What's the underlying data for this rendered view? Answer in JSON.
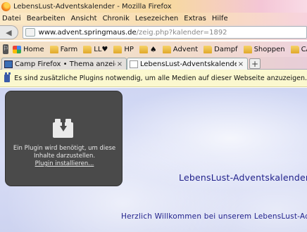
{
  "window": {
    "title": "LebensLust-Adventskalender - Mozilla Firefox"
  },
  "menu": [
    "Datei",
    "Bearbeiten",
    "Ansicht",
    "Chronik",
    "Lesezeichen",
    "Extras",
    "Hilfe"
  ],
  "navigation": {
    "url_domain": "www.advent.springmaus.de",
    "url_path": "/zeig.php?kalender=1892"
  },
  "bookmarks": [
    {
      "label": "Home",
      "icon": "google-icon"
    },
    {
      "label": "Farm",
      "icon": "folder-icon"
    },
    {
      "label": "LL♥",
      "icon": "folder-icon"
    },
    {
      "label": "HP",
      "icon": "folder-icon"
    },
    {
      "label": "♠",
      "icon": "spade-icon"
    },
    {
      "label": "Advent",
      "icon": "folder-icon"
    },
    {
      "label": "Dampf",
      "icon": "folder-icon"
    },
    {
      "label": "Shoppen",
      "icon": "folder-icon"
    },
    {
      "label": "CA$H",
      "icon": "folder-icon"
    }
  ],
  "tabs": [
    {
      "label": "Camp Firefox • Thema anzeigen ...",
      "close": "×"
    },
    {
      "label": "LebensLust-Adventskalender",
      "close": "×"
    }
  ],
  "new_tab_label": "+",
  "notification": {
    "text": "Es sind zusätzliche Plugins notwendig, um alle Medien auf dieser Webseite anzuzeigen."
  },
  "plugin": {
    "message": "Ein Plugin wird benötigt, um diese Inhalte darzustellen.",
    "link": "Plugin installieren..."
  },
  "page": {
    "heading": "LebensLust-Adventskalender",
    "welcome": "Herzlich Willkommen bei unserem LebensLust-Adve"
  },
  "colors": {
    "heading": "#1f1f8a",
    "plugin_box": "#4a4a4a",
    "notification_bg": "#fbf8cf"
  }
}
